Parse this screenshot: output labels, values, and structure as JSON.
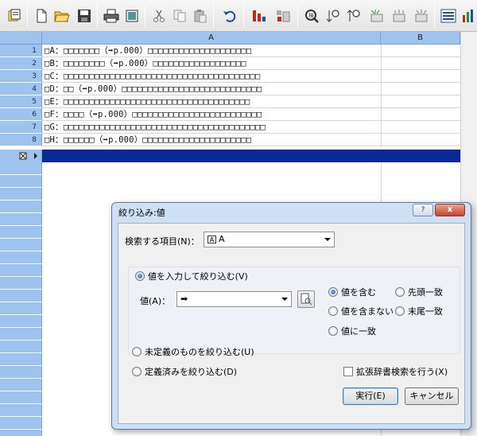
{
  "toolbar": {
    "buttons": [
      "new-file-icon",
      "open-folder-icon",
      "save-icon",
      "print-icon",
      "print-preview-icon",
      "cut-icon",
      "copy-icon",
      "paste-icon",
      "undo-icon",
      "sort-icon",
      "filter-icon",
      "search-icon",
      "find-down-icon",
      "find-up-icon",
      "data-icon-1",
      "data-icon-2",
      "data-icon-3",
      "list-view-icon",
      "chart-icon"
    ]
  },
  "grid": {
    "columns": [
      "A",
      "B"
    ],
    "rows": [
      {
        "num": "1",
        "text": "□A：□□□□□□□（➡p.000）□□□□□□□□□□□□□□□□□□□□"
      },
      {
        "num": "2",
        "text": "□B：□□□□□□□□（➡p.000）□□□□□□□□□□□□□□□□□□"
      },
      {
        "num": "3",
        "text": "□C：□□□□□□□□□□□□□□□□□□□□□□□□□□□□□□□□□□□□□□"
      },
      {
        "num": "4",
        "text": "□D：□□（➡p.000）□□□□□□□□□□□□□□□□□□□□□□□□□□□"
      },
      {
        "num": "5",
        "text": "□E：□□□□□□□□□□□□□□□□□□□□□□□□□□□□□□□□□□□□"
      },
      {
        "num": "6",
        "text": "□F：□□□□（➡p.000）□□□□□□□□□□□□□□□□□□□□□□□□□"
      },
      {
        "num": "7",
        "text": "□G：□□□□□□□□□□□□□□□□□□□□□□□□□□□□□□□□□□□□□□□"
      },
      {
        "num": "8",
        "text": "□H：□□□□□□（➡p.000）□□□□□□□□□□□□□□□□□□□□□"
      }
    ]
  },
  "dialog": {
    "title": "絞り込み:値",
    "help_label": "?",
    "close_label": "x",
    "search_item_label": "検索する項目(N)：",
    "search_item_icon_label": "A",
    "search_item_value": "A",
    "input_mode_label": "値を入力して絞り込む(V)",
    "value_label": "値(A)：",
    "value_value": "➡",
    "match_options": {
      "contains": "値を含む",
      "not_contains": "値を含まない",
      "equals": "値に一致",
      "prefix": "先頭一致",
      "suffix": "末尾一致"
    },
    "undefined_label": "未定義のものを絞り込む(U)",
    "defined_label": "定義済みを絞り込む(D)",
    "extended_search_label": "拡張辞書検索を行う(X)",
    "execute_label": "実行(E)",
    "cancel_label": "キャンセル"
  }
}
